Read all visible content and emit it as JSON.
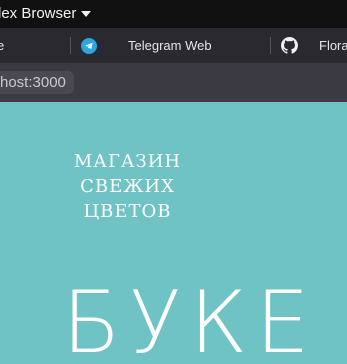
{
  "window": {
    "title": "lex Browser"
  },
  "bookmarks": [
    {
      "label": "e",
      "icon": "",
      "label_left": -2
    },
    {
      "label": "Telegram Web",
      "icon": "telegram-icon"
    },
    {
      "label": "Flora",
      "icon": "github-icon"
    }
  ],
  "address_bar": {
    "url": "host:3000"
  },
  "page": {
    "logo_lines": [
      "МАГАЗИН",
      "СВЕЖИХ",
      "ЦВЕТОВ"
    ],
    "hero_text": "БУКЕ"
  },
  "colors": {
    "page_background": "#6fc3c5",
    "titlebar": "#111111",
    "bookmarks_bar": "#2a2930",
    "address_bar": "#3b3a42",
    "telegram_blue": "#2ca5e0"
  }
}
